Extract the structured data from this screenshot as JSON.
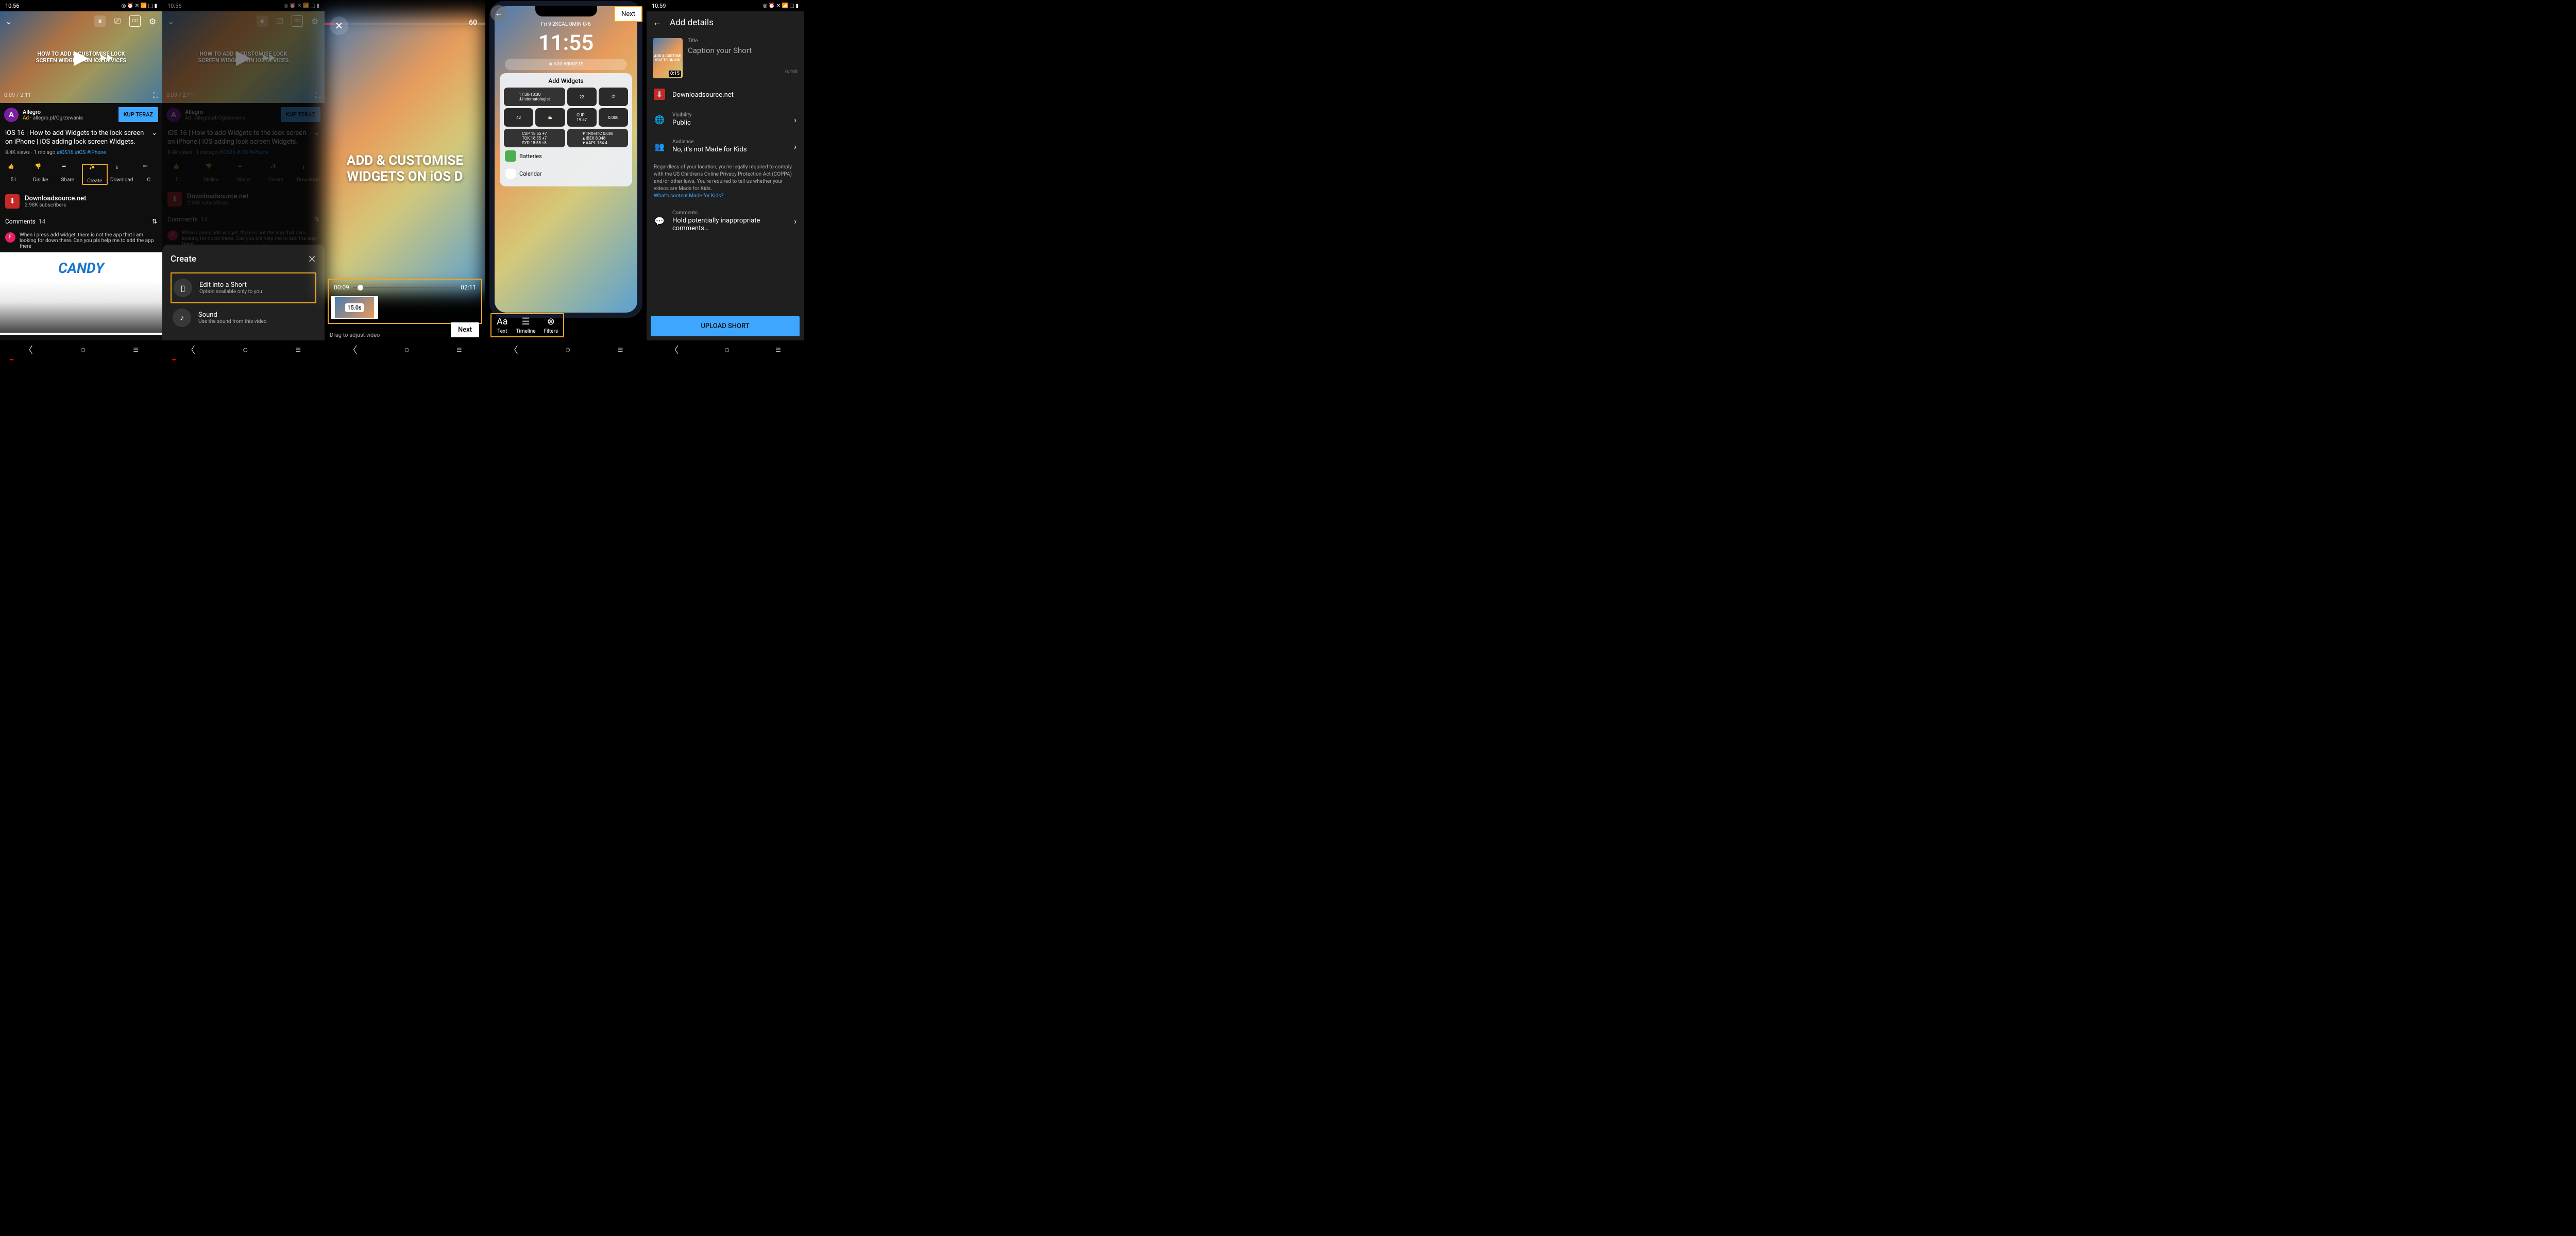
{
  "status": {
    "time1": "10:56",
    "time5": "10:59"
  },
  "player": {
    "overlay_title": "HOW TO ADD & CUSTOMISE LOCK\nSCREEN WIDGETS ON iOS DEVICES",
    "time_cur": "0:09",
    "time_total": "2:11"
  },
  "ad": {
    "title": "Allegro",
    "tag": "Ad",
    "url": "allegro.pl/Ogrzewanie",
    "cta": "KUP TERAZ"
  },
  "video": {
    "title": "iOS 16 | How to add Widgets to the lock screen on iPhone | iOS adding lock screen Widgets.",
    "views": "8.4K views",
    "age": "1 mo ago",
    "tags": [
      "#iOS16",
      "#iOS",
      "#iPhone"
    ]
  },
  "actions": {
    "like": "51",
    "dislike": "Dislike",
    "share": "Share",
    "create": "Create",
    "download": "Download",
    "clip": "C"
  },
  "channel": {
    "name": "Downloadsource.net",
    "subs": "2.98K subscribers"
  },
  "comments": {
    "label": "Comments",
    "count": "14",
    "top": "When i press add widget, there is not the app that i am looking for down there. Can you pls help me to add the app there"
  },
  "banner": {
    "brand": "CANDY"
  },
  "sheet": {
    "title": "Create",
    "edit": {
      "title": "Edit into a Short",
      "sub": "Option available only to you"
    },
    "sound": {
      "title": "Sound",
      "sub": "Use the sound from this video"
    }
  },
  "editor": {
    "duration": "60",
    "start": "00:09",
    "end": "02:11",
    "clip": "15.0s",
    "hint": "Drag to adjust video",
    "next": "Next",
    "text1": "ADD & CUSTOMISE",
    "text2": "WIDGETS ON iOS D"
  },
  "preview": {
    "next": "Next",
    "lock_date": "Fri 9   2KCAL 0MIN 0/6",
    "lock_time": "11:55",
    "add_widgets": "⊕ ADD WIDGETS",
    "panel_title": "Add Widgets",
    "batt": "Batteries",
    "cal": "Calendar",
    "tools": {
      "text": "Text",
      "timeline": "Timeline",
      "filters": "Filters"
    }
  },
  "details": {
    "title": "Add details",
    "caption_label": "Title",
    "caption_placeholder": "Caption your Short",
    "count": "0/100",
    "dur": "0:15",
    "channel": "Downloadsource.net",
    "visibility": {
      "label": "Visibility",
      "value": "Public"
    },
    "audience": {
      "label": "Audience",
      "value": "No, it's not Made for Kids"
    },
    "legal": "Regardless of your location, you're legally required to comply with the US Children's Online Privacy Protection Act (COPPA) and/or other laws. You're required to tell us whether your videos are Made for Kids.",
    "legal_link": "What's content Made for Kids?",
    "comments": {
      "label": "Comments",
      "value": "Hold potentially inappropriate comments…"
    },
    "upload": "UPLOAD SHORT"
  }
}
